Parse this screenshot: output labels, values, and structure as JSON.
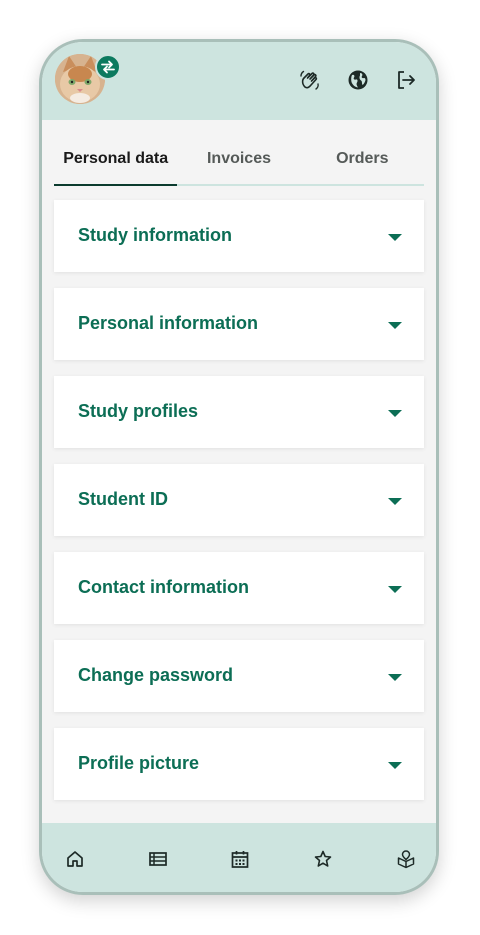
{
  "header": {
    "icons": [
      "avatar",
      "switch-account-icon",
      "wave-hand-icon",
      "globe-icon",
      "logout-icon"
    ]
  },
  "tabs": [
    {
      "label": "Personal data",
      "active": true
    },
    {
      "label": "Invoices",
      "active": false
    },
    {
      "label": "Orders",
      "active": false
    }
  ],
  "sections": [
    {
      "label": "Study information"
    },
    {
      "label": "Personal information"
    },
    {
      "label": "Study profiles"
    },
    {
      "label": "Student ID"
    },
    {
      "label": "Contact information"
    },
    {
      "label": "Change password"
    },
    {
      "label": "Profile picture"
    }
  ],
  "bottom_nav": [
    "home-icon",
    "list-icon",
    "calendar-icon",
    "star-icon",
    "map-icon"
  ],
  "colors": {
    "header_bg": "#cde4df",
    "accent": "#0c6e55",
    "badge": "#0c7a5f",
    "content_bg": "#f4f4f4"
  }
}
